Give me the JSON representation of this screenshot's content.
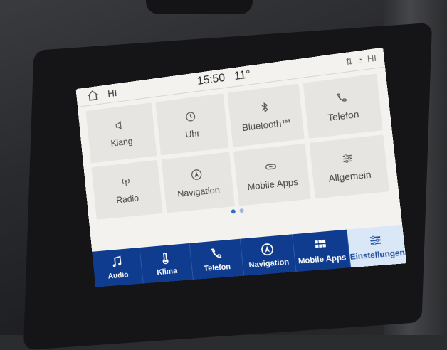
{
  "status": {
    "left": "HI",
    "time": "15:50",
    "temp": "11°",
    "right": "HI"
  },
  "tiles": [
    {
      "label": "Klang",
      "icon": "speaker-icon"
    },
    {
      "label": "Uhr",
      "icon": "clock-icon"
    },
    {
      "label": "Bluetooth™",
      "icon": "bluetooth-icon"
    },
    {
      "label": "Telefon",
      "icon": "phone-icon"
    },
    {
      "label": "Radio",
      "icon": "radio-icon"
    },
    {
      "label": "Navigation",
      "icon": "navigation-icon"
    },
    {
      "label": "Mobile Apps",
      "icon": "link-icon"
    },
    {
      "label": "Allgemein",
      "icon": "sliders-icon"
    }
  ],
  "bottom_bar": [
    {
      "label": "Audio",
      "icon": "music-icon"
    },
    {
      "label": "Klima",
      "icon": "thermometer-icon"
    },
    {
      "label": "Telefon",
      "icon": "phone-icon"
    },
    {
      "label": "Navigation",
      "icon": "navigation-icon"
    },
    {
      "label": "Mobile Apps",
      "icon": "apps-icon"
    },
    {
      "label": "Einstellungen",
      "icon": "settings-sliders-icon",
      "active": true
    }
  ],
  "colors": {
    "bar": "#0f3c8f",
    "active_tab": "#d9e7f7",
    "accent": "#2f6cc8"
  }
}
